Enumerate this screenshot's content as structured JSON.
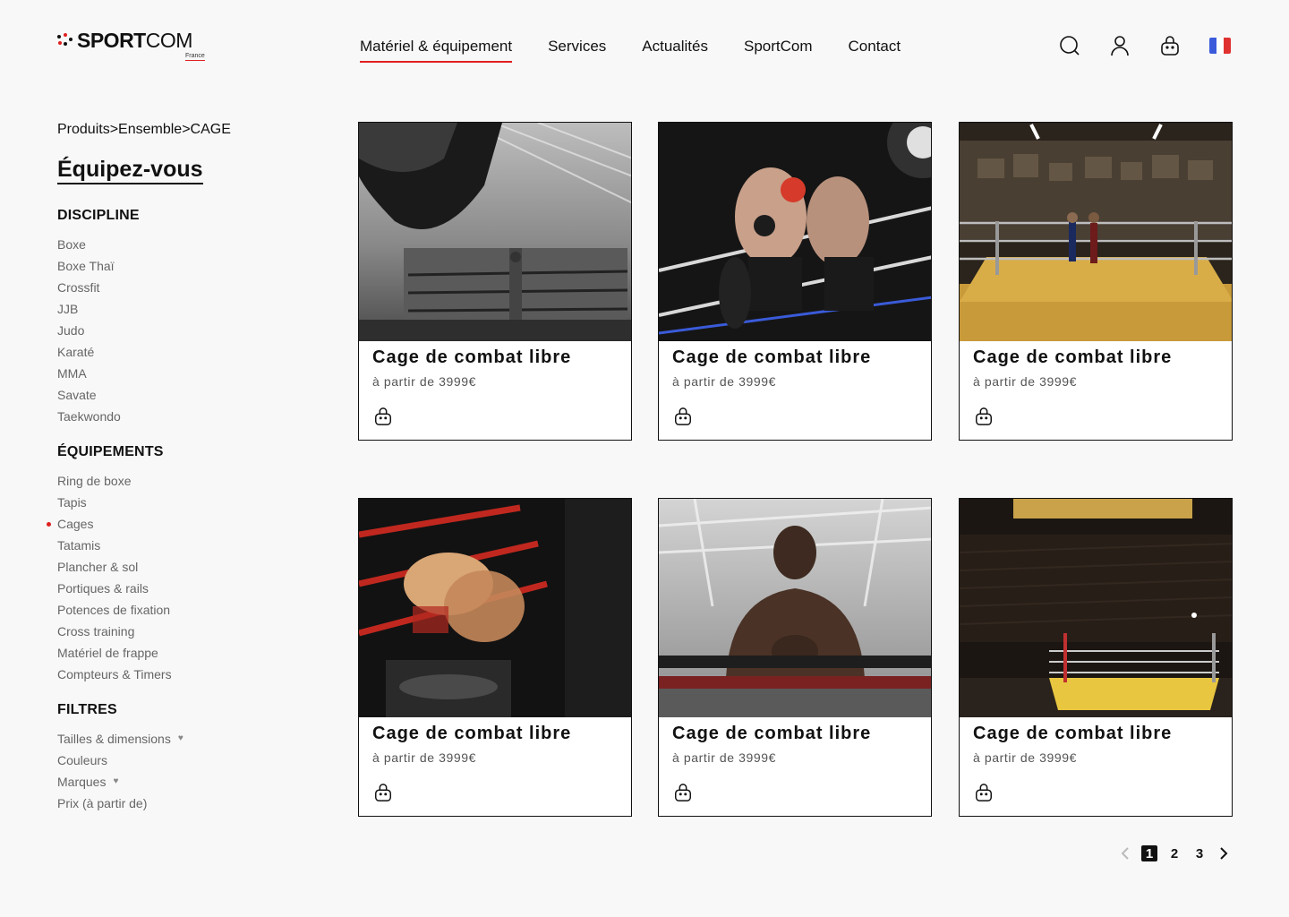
{
  "brand": {
    "name_bold": "SPORT",
    "name_light": "COM",
    "sub": "France"
  },
  "nav": {
    "items": [
      {
        "label": "Matériel & équipement",
        "active": true
      },
      {
        "label": "Services"
      },
      {
        "label": "Actualités"
      },
      {
        "label": "SportCom"
      },
      {
        "label": "Contact"
      }
    ]
  },
  "header_icons": [
    "search-icon",
    "user-icon",
    "bag-icon",
    "flag-fr-icon"
  ],
  "breadcrumb": "Produits>Ensemble>CAGE",
  "page_title": "Équipez-vous",
  "sidebar": {
    "discipline": {
      "title": "DISCIPLINE",
      "items": [
        "Boxe",
        "Boxe Thaï",
        "Crossfit",
        "JJB",
        "Judo",
        "Karaté",
        "MMA",
        "Savate",
        "Taekwondo"
      ]
    },
    "equipements": {
      "title": "ÉQUIPEMENTS",
      "items": [
        "Ring de boxe",
        "Tapis",
        "Cages",
        "Tatamis",
        "Plancher & sol",
        "Portiques & rails",
        "Potences de fixation",
        "Cross training",
        "Matériel de frappe",
        "Compteurs & Timers"
      ],
      "active": "Cages"
    },
    "filtres": {
      "title": "FILTRES",
      "items": [
        "Tailles & dimensions",
        "Couleurs",
        "Marques",
        "Prix (à partir de)"
      ]
    }
  },
  "products": [
    {
      "name": "Cage de combat libre",
      "price": "à partir de 3999€"
    },
    {
      "name": "Cage de combat libre",
      "price": "à partir de 3999€"
    },
    {
      "name": "Cage de combat libre",
      "price": "à partir de 3999€"
    },
    {
      "name": "Cage de combat libre",
      "price": "à partir de 3999€"
    },
    {
      "name": "Cage de combat libre",
      "price": "à partir de 3999€"
    },
    {
      "name": "Cage de combat libre",
      "price": "à partir de 3999€"
    }
  ],
  "pagination": {
    "pages": [
      "1",
      "2",
      "3"
    ],
    "current": "1"
  },
  "colors": {
    "accent": "#e02020",
    "text": "#111111",
    "muted": "#666666",
    "background": "#f8f8f8"
  }
}
